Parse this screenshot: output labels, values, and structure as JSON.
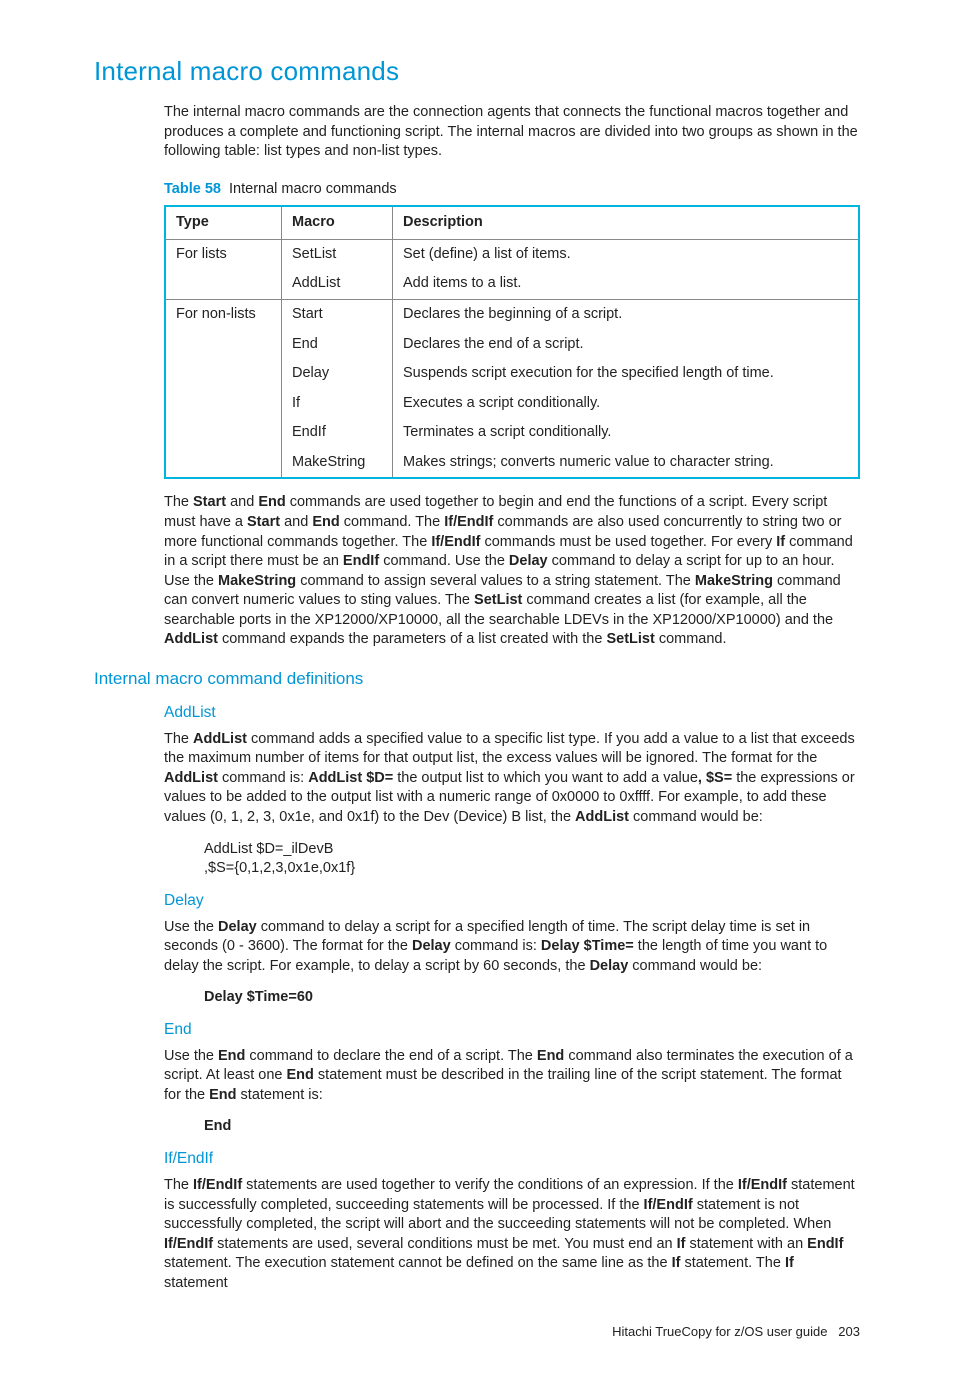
{
  "h1": "Internal macro commands",
  "intro": "The internal macro commands are the connection agents that connects the functional macros together and produces a complete and functioning script. The internal macros are divided into two groups as shown in the following table: list types and non-list types.",
  "table_caption_label": "Table 58",
  "table_caption_text": "Internal macro commands",
  "th": {
    "type": "Type",
    "macro": "Macro",
    "desc": "Description"
  },
  "rows": {
    "r1": {
      "type": "For lists",
      "macro": "SetList",
      "desc": "Set (define) a list of items."
    },
    "r2": {
      "macro": "AddList",
      "desc": "Add items to a list."
    },
    "r3": {
      "type": "For non-lists",
      "macro": "Start",
      "desc": "Declares the beginning of a script."
    },
    "r4": {
      "macro": "End",
      "desc": "Declares the end of a script."
    },
    "r5": {
      "macro": "Delay",
      "desc": "Suspends script execution for the specified length of time."
    },
    "r6": {
      "macro": "If",
      "desc": "Executes a script conditionally."
    },
    "r7": {
      "macro": "EndIf",
      "desc": "Terminates a script conditionally."
    },
    "r8": {
      "macro": "MakeString",
      "desc": "Makes strings; converts numeric value to character string."
    }
  },
  "para2_html": "The <b>Start</b> and <b>End</b> commands are used together to begin and end the functions of a script. Every script must have a <b>Start</b> and <b>End</b> command. The <b>If/EndIf</b> commands are also used concurrently to string two or more functional commands together. The <b>If/EndIf</b> commands must be used together. For every <b>If</b> command in a script there must be an <b>EndIf</b> command. Use the <b>Delay</b> command to delay a script for up to an hour. Use the <b>MakeString</b> command to assign several values to a string statement. The <b>MakeString</b> command can convert numeric values to sting values. The <b>SetList</b> command creates a list (for example, all the searchable ports in the XP12000/XP10000, all the searchable LDEVs in the XP12000/XP10000) and the <b>AddList</b> command expands the parameters of a list created with the <b>SetList</b> command.",
  "h2": "Internal macro command definitions",
  "addlist": {
    "h": "AddList",
    "p_html": "The <b>AddList</b> command adds a specified value to a specific list type. If you add a value to a list that exceeds the maximum number of items for that output list, the excess values will be ignored. The format for the <b>AddList</b> command is: <b>AddList $D=</b> the output list to which you want to add a value<b>, $S=</b> the expressions or values to be added to the output list with a numeric range of 0x0000 to 0xffff. For example, to add these values (0, 1, 2, 3, 0x1e, and 0x1f) to the Dev (Device) B list, the <b>AddList</b> command would be:",
    "code1": "AddList $D=_ilDevB",
    "code2": ",$S={0,1,2,3,0x1e,0x1f}"
  },
  "delay": {
    "h": "Delay",
    "p_html": "Use the <b>Delay</b> command to delay a script for a specified length of time. The script delay time is set in seconds (0 - 3600). The format for the <b>Delay</b> command is: <b>Delay $Time=</b> the length of time you want to delay the script. For example, to delay a script by 60 seconds, the <b>Delay</b> command would be:",
    "ex": "Delay $Time=60"
  },
  "end": {
    "h": "End",
    "p_html": "Use the <b>End</b> command to declare the end of a script. The <b>End</b> command also terminates the execution of a script. At least one <b>End</b> statement must be described in the trailing line of the script statement. The format for the <b>End</b> statement is:",
    "ex": "End"
  },
  "ifendif": {
    "h": "If/EndIf",
    "p_html": "The <b>If/EndIf</b> statements are used together to verify the conditions of an expression. If the <b>If/EndIf</b> statement is successfully completed, succeeding statements will be processed. If the <b>If/EndIf</b> statement is not successfully completed, the script will abort and the succeeding statements will not be completed. When <b>If/EndIf</b> statements are used, several conditions must be met. You must end an <b>If</b> statement with an <b>EndIf</b> statement. The execution statement cannot be defined on the same line as the <b>If</b> statement. The <b>If</b> statement"
  },
  "footer_text": "Hitachi TrueCopy for z/OS user guide",
  "footer_page": "203"
}
